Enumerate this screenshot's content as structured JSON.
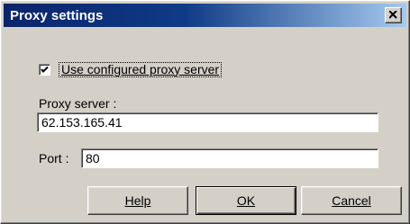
{
  "window": {
    "title": "Proxy settings"
  },
  "proxy": {
    "use_configured_label": "Use configured proxy server",
    "use_configured_checked": true,
    "server_label": "Proxy server :",
    "server_value": "62.153.165.41",
    "port_label": "Port :",
    "port_value": "80"
  },
  "buttons": {
    "help": "Help",
    "ok": "OK",
    "cancel": "Cancel"
  },
  "icons": {
    "close": "close-icon",
    "check": "checkmark-icon"
  }
}
